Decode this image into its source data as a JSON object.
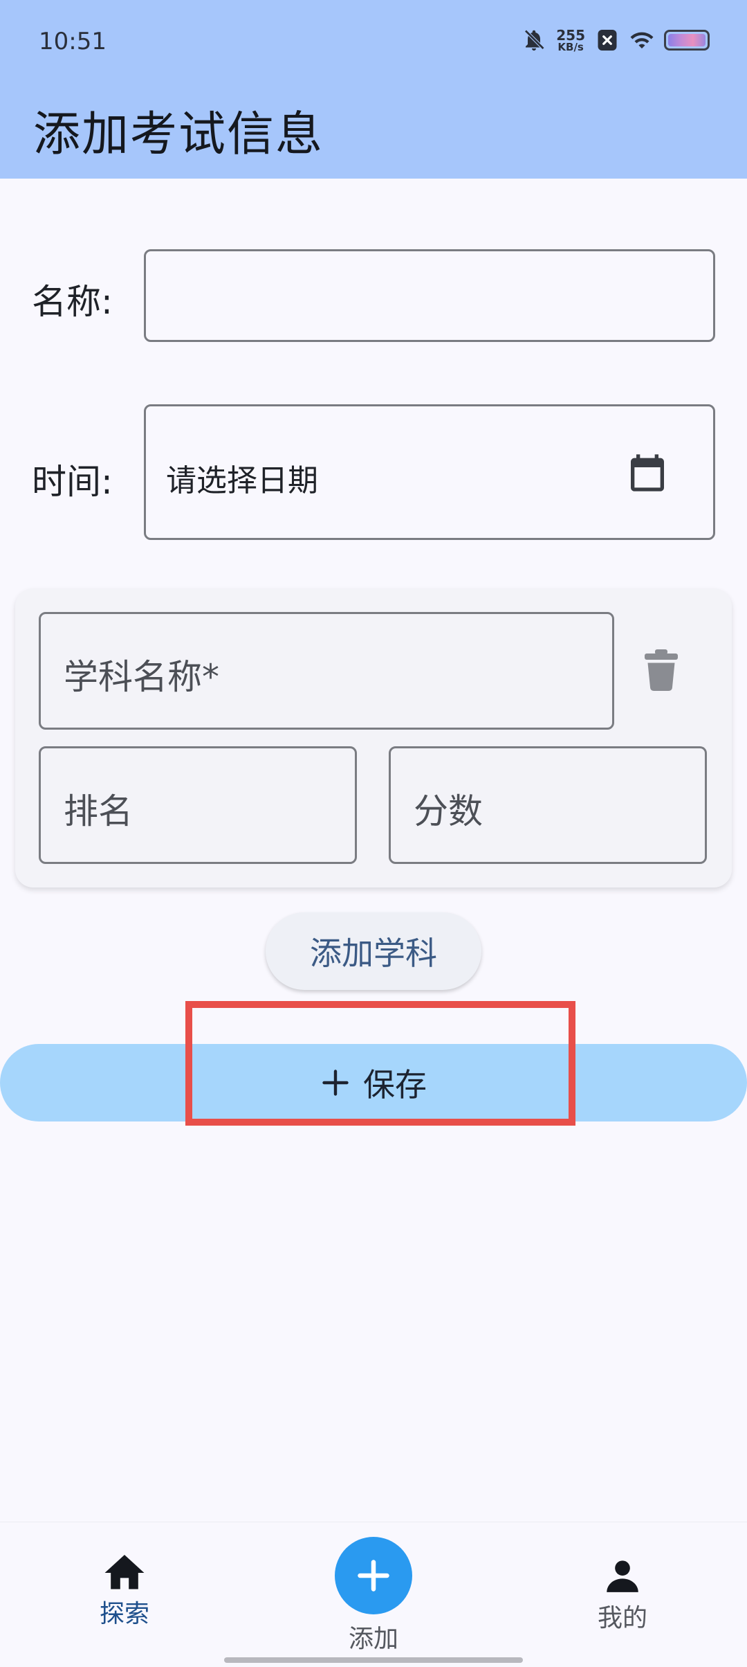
{
  "status_bar": {
    "time": "10:51",
    "net_speed_value": "255",
    "net_speed_unit": "KB/s",
    "icons": [
      "mute-bell-icon",
      "close-badge-icon",
      "wifi-icon",
      "battery-icon"
    ]
  },
  "header": {
    "title": "添加考试信息"
  },
  "form": {
    "name_label": "名称:",
    "name_value": "",
    "time_label": "时间:",
    "date_placeholder": "请选择日期"
  },
  "subject_card": {
    "subject_name_placeholder": "学科名称*",
    "rank_placeholder": "排名",
    "score_placeholder": "分数"
  },
  "actions": {
    "add_subject_label": "添加学科",
    "save_label": "保存"
  },
  "bottom_nav": {
    "items": [
      {
        "label": "探索",
        "icon": "home-icon",
        "active": true
      },
      {
        "label": "添加",
        "icon": "add-icon",
        "active": false
      },
      {
        "label": "我的",
        "icon": "person-icon",
        "active": false
      }
    ]
  },
  "colors": {
    "header_bg": "#a6c6fb",
    "save_button_bg": "#a6d6fc",
    "add_fab": "#2a9af0",
    "active_nav": "#1e4f8c",
    "highlight": "#e84f4a"
  }
}
